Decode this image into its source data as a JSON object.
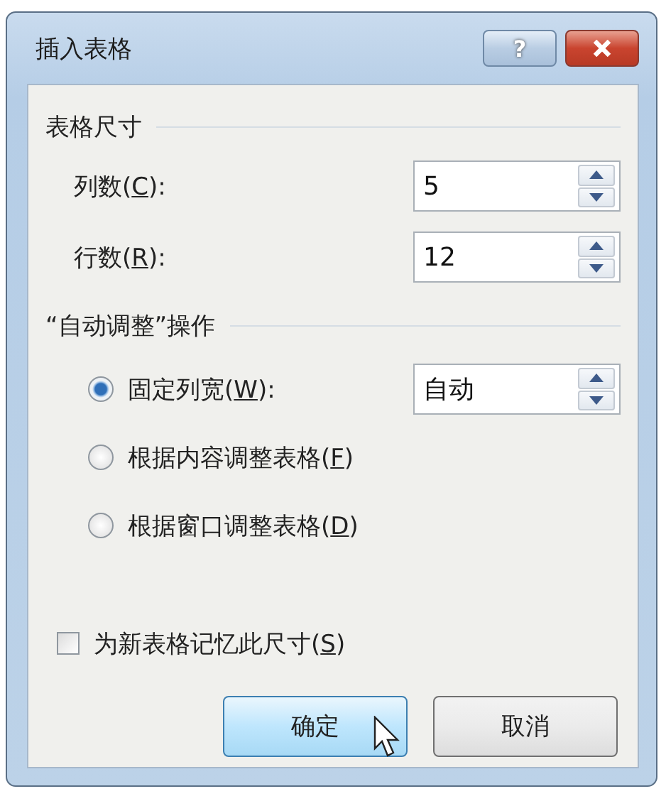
{
  "window": {
    "title": "插入表格",
    "buttons": [
      {
        "kind": "help",
        "label": "?"
      },
      {
        "kind": "close"
      }
    ]
  },
  "table_size": {
    "heading": "表格尺寸",
    "fields": [
      {
        "label": "列数(",
        "mnemonic": "C",
        "label_end": "):",
        "value": "5"
      },
      {
        "label": "行数(",
        "mnemonic": "R",
        "label_end": "):",
        "value": "12"
      }
    ]
  },
  "autofit": {
    "heading": "“自动调整”操作",
    "options": [
      {
        "label": "固定列宽(",
        "mnemonic": "W",
        "label_end": "):",
        "selected": true,
        "value": "自动"
      },
      {
        "label": "根据内容调整表格(",
        "mnemonic": "F",
        "label_end": ")",
        "selected": false
      },
      {
        "label": "根据窗口调整表格(",
        "mnemonic": "D",
        "label_end": ")",
        "selected": false
      }
    ]
  },
  "remember": {
    "label": "为新表格记忆此尺寸(",
    "mnemonic": "S",
    "label_end": ")",
    "checked": false
  },
  "buttons": [
    {
      "label": "确定",
      "kind": "default"
    },
    {
      "label": "取消",
      "kind": "normal"
    }
  ]
}
